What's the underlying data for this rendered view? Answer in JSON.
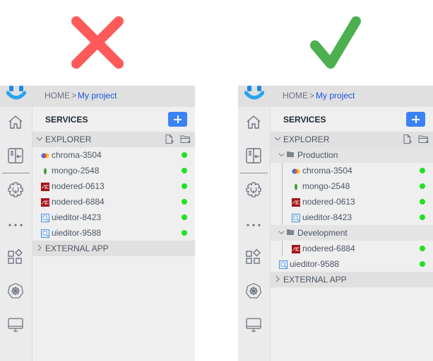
{
  "verdicts": {
    "left": {
      "icon": "cross-icon",
      "color": "#ff5a5a",
      "meaning": "incorrect"
    },
    "right": {
      "icon": "checkmark-icon",
      "color": "#4caf50",
      "meaning": "correct"
    }
  },
  "panels": {
    "left": {
      "breadcrumb": {
        "home": "HOME",
        "separator": ">",
        "current": "My project"
      },
      "services_title": "SERVICES",
      "add_button_label": "+",
      "explorer_label": "EXPLORER",
      "external_app_label": "EXTERNAL APP",
      "items": [
        {
          "name": "chroma-3504",
          "type": "chroma",
          "status": "running"
        },
        {
          "name": "mongo-2548",
          "type": "mongo",
          "status": "running"
        },
        {
          "name": "nodered-0613",
          "type": "nodered",
          "status": "running"
        },
        {
          "name": "nodered-6884",
          "type": "nodered",
          "status": "running"
        },
        {
          "name": "uieditor-8423",
          "type": "uieditor",
          "status": "running"
        },
        {
          "name": "uieditor-9588",
          "type": "uieditor",
          "status": "running"
        }
      ]
    },
    "right": {
      "breadcrumb": {
        "home": "HOME",
        "separator": ">",
        "current": "My project"
      },
      "services_title": "SERVICES",
      "add_button_label": "+",
      "explorer_label": "EXPLORER",
      "external_app_label": "EXTERNAL APP",
      "folders": [
        {
          "name": "Production",
          "expanded": true,
          "items": [
            {
              "name": "chroma-3504",
              "type": "chroma",
              "status": "running"
            },
            {
              "name": "mongo-2548",
              "type": "mongo",
              "status": "running"
            },
            {
              "name": "nodered-0613",
              "type": "nodered",
              "status": "running"
            },
            {
              "name": "uieditor-8423",
              "type": "uieditor",
              "status": "running"
            }
          ]
        },
        {
          "name": "Development",
          "expanded": true,
          "items": [
            {
              "name": "nodered-6884",
              "type": "nodered",
              "status": "running"
            }
          ]
        }
      ],
      "ungrouped": [
        {
          "name": "uieditor-9588",
          "type": "uieditor",
          "status": "running"
        }
      ]
    }
  },
  "rail_icons": [
    "home-icon",
    "collapse-panel-icon",
    "settings-icon",
    "more-icon",
    "apps-icon",
    "kubernetes-icon",
    "monitor-icon"
  ],
  "colors": {
    "accent": "#3b82f6",
    "status_running": "#22e022",
    "link": "#1a56db"
  }
}
